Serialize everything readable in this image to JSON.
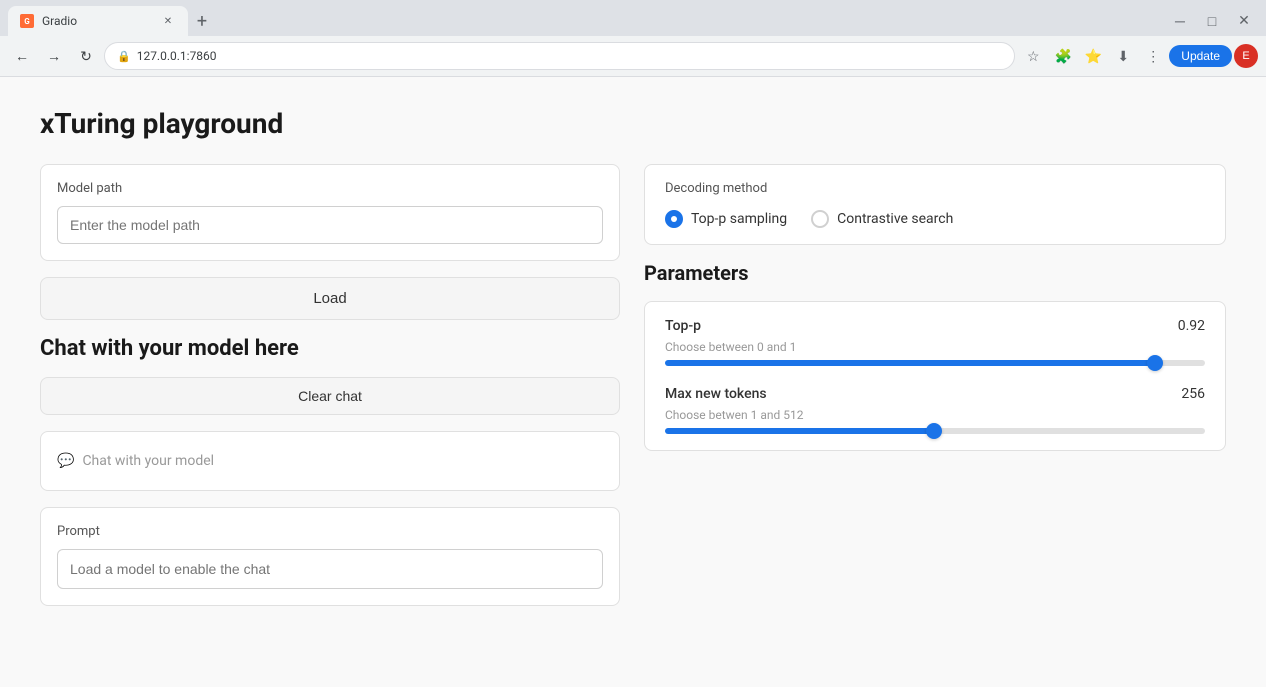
{
  "browser": {
    "tab_title": "Gradio",
    "tab_favicon": "G",
    "url": "127.0.0.1:7860",
    "update_btn": "Update",
    "profile_initial": "E"
  },
  "page": {
    "title": "xTuring playground"
  },
  "left": {
    "model_path_label": "Model path",
    "model_path_placeholder": "Enter the model path",
    "load_btn": "Load",
    "chat_section_title": "Chat with your model here",
    "clear_chat_btn": "Clear chat",
    "chat_placeholder": "Chat with your model",
    "prompt_label": "Prompt",
    "prompt_placeholder": "Load a model to enable the chat"
  },
  "right": {
    "decoding_label": "Decoding method",
    "decoding_options": [
      {
        "id": "top-p",
        "label": "Top-p sampling",
        "selected": true
      },
      {
        "id": "contrastive",
        "label": "Contrastive search",
        "selected": false
      }
    ],
    "params_title": "Parameters",
    "top_p": {
      "name": "Top-p",
      "hint": "Choose between 0 and 1",
      "value": "0.92",
      "percent": 92
    },
    "max_tokens": {
      "name": "Max new tokens",
      "hint": "Choose betwen 1 and 512",
      "value": "256",
      "percent": 49
    }
  }
}
